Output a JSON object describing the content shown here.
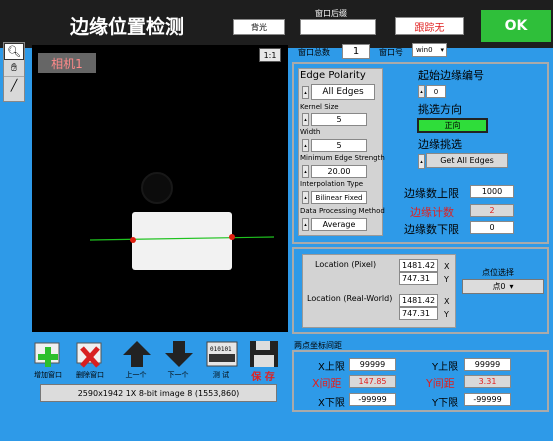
{
  "header": {
    "title": "边缘位置检测",
    "top_label": "窗口后缀",
    "light_value": "背光",
    "suffix_value": "",
    "tracking_value": "跟踪无",
    "ok_label": "OK"
  },
  "toolbar": {
    "zoom_tag": "1:1"
  },
  "viewer": {
    "camera_label": "相机1"
  },
  "window_bar": {
    "total_label": "窗口总数",
    "total_value": "1",
    "id_label": "窗口号",
    "id_value": "win0"
  },
  "edge_panel": {
    "polarity_label": "Edge Polarity",
    "polarity_value": "All Edges",
    "kernel_label": "Kernel Size",
    "kernel_value": "5",
    "width_label": "Width",
    "width_value": "5",
    "min_strength_label": "Minimum Edge Strength",
    "min_strength_value": "20.00",
    "interp_label": "Interpolation Type",
    "interp_value": "Bilinear Fixed",
    "dpm_label": "Data Processing Method",
    "dpm_value": "Average"
  },
  "edge_right": {
    "start_label": "起始边缘编号",
    "start_value": "0",
    "direction_label": "挑选方向",
    "direction_value": "正向",
    "pick_label": "边缘挑选",
    "pick_value": "Get All Edges",
    "upper_label": "边缘数上限",
    "upper_value": "1000",
    "count_label": "边缘计数",
    "count_value": "2",
    "lower_label": "边缘数下限",
    "lower_value": "0"
  },
  "location": {
    "pixel_label": "Location (Pixel)",
    "pixel_x": "1481.42",
    "pixel_y": "747.31",
    "world_label": "Location (Real-World)",
    "world_x": "1481.42",
    "world_y": "747.31",
    "x_axis": "X",
    "y_axis": "Y",
    "point_select_label": "点位选择",
    "point_select_value": "点0"
  },
  "distance": {
    "section_label": "两点坐标间距",
    "x_upper_label": "X上限",
    "x_upper_value": "99999",
    "y_upper_label": "Y上限",
    "y_upper_value": "99999",
    "x_dist_label": "X间距",
    "x_dist_value": "147.85",
    "y_dist_label": "Y间距",
    "y_dist_value": "3.31",
    "x_lower_label": "X下限",
    "x_lower_value": "-99999",
    "y_lower_label": "Y下限",
    "y_lower_value": "-99999"
  },
  "actions": {
    "add_label": "增加窗口",
    "delete_label": "删除窗口",
    "prev_label": "上一个",
    "next_label": "下一个",
    "test_label": "测 试",
    "save_label": "保 存"
  },
  "statusbar": {
    "image_info": "2590x1942 1X 8-bit image 8      (1553,860)"
  },
  "colors": {
    "background": "#2e9ae8",
    "accent_green": "#2fbf3a",
    "red_text": "#e02020",
    "edge_line": "#1fc21f",
    "edge_point": "#e02010"
  }
}
